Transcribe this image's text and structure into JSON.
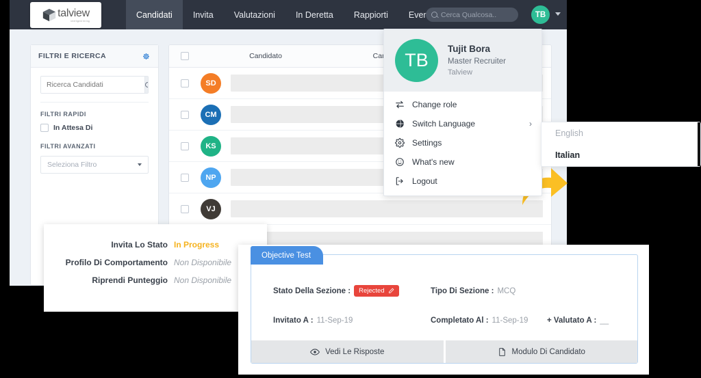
{
  "navbar": {
    "logo_text": "talview",
    "logo_tagline": "intelligent hiring",
    "logo_icon": "cube-icon",
    "items": [
      {
        "label": "Candidati",
        "active": true
      },
      {
        "label": "Invita",
        "active": false
      },
      {
        "label": "Valutazioni",
        "active": false
      },
      {
        "label": "In Deretta",
        "active": false
      },
      {
        "label": "Rappiorti",
        "active": false
      },
      {
        "label": "Eventi",
        "active": false
      }
    ],
    "search_placeholder": "Cerca Qualcosa..",
    "avatar_initials": "TB"
  },
  "sidebar": {
    "title": "FILTRI E RICERCA",
    "gear_icon": "gear-icon",
    "search_placeholder": "Ricerca Candidati",
    "quick_filters_label": "FILTRI RAPIDI",
    "quick_filters": [
      {
        "label": "In Attesa Di",
        "checked": false
      }
    ],
    "advanced_filters_label": "FILTRI AVANZATI",
    "advanced_select_value": "Seleziona Filtro"
  },
  "table": {
    "columns": [
      "Candidato",
      "Candidato #"
    ],
    "rows": [
      {
        "initials": "SD",
        "color": "#f47d26"
      },
      {
        "initials": "CM",
        "color": "#1b6fb5"
      },
      {
        "initials": "KS",
        "color": "#1fb386"
      },
      {
        "initials": "NP",
        "color": "#4ea6f0"
      },
      {
        "initials": "VJ",
        "color": "#403b36"
      }
    ]
  },
  "profile_menu": {
    "avatar_initials": "TB",
    "name": "Tujit Bora",
    "role": "Master Recruiter",
    "org": "Talview",
    "items": [
      {
        "label": "Change role",
        "icon": "swap-arrows-icon",
        "has_submenu": false
      },
      {
        "label": "Switch Language",
        "icon": "globe-icon",
        "has_submenu": true,
        "chevron": "›"
      },
      {
        "label": "Settings",
        "icon": "gear-icon",
        "has_submenu": false
      },
      {
        "label": "What's new",
        "icon": "smiley-icon",
        "has_submenu": false
      },
      {
        "label": "Logout",
        "icon": "logout-icon",
        "has_submenu": false
      }
    ]
  },
  "language_menu": {
    "options": [
      {
        "label": "English",
        "selected": false
      },
      {
        "label": "Italian",
        "selected": true
      }
    ]
  },
  "callout_panel": {
    "rows": [
      {
        "key": "Invita Lo Stato",
        "value": "In Progress",
        "state": "progress"
      },
      {
        "key": "Profilo Di Comportamento",
        "value": "Non Disponibile",
        "state": "muted"
      },
      {
        "key": "Riprendi Punteggio",
        "value": "Non Disponibile",
        "state": "muted"
      }
    ]
  },
  "objective_test": {
    "tab_label": "Objective Test",
    "section_status_label": "Stato Della Sezione :",
    "section_status_badge": "Rejected",
    "badge_edit_icon": "pencil-icon",
    "section_type_label": "Tipo Di Sezione :",
    "section_type_value": "MCQ",
    "invited_label": "Invitato A :",
    "invited_value": "11-Sep-19",
    "completed_label": "Completato Al :",
    "completed_value": "11-Sep-19",
    "evaluated_label": "+ Valutato A :",
    "evaluated_value": "__",
    "buttons": [
      {
        "label": "Vedi Le Risposte",
        "icon": "eye-icon"
      },
      {
        "label": "Modulo Di Candidato",
        "icon": "document-icon"
      }
    ]
  },
  "colors": {
    "navbar_bg": "#2e3440",
    "accent_teal": "#2ebd96",
    "accent_blue": "#4a90e2",
    "status_red": "#e8453c",
    "status_amber": "#f5b21e",
    "arrow_yellow": "#fbbf24"
  }
}
